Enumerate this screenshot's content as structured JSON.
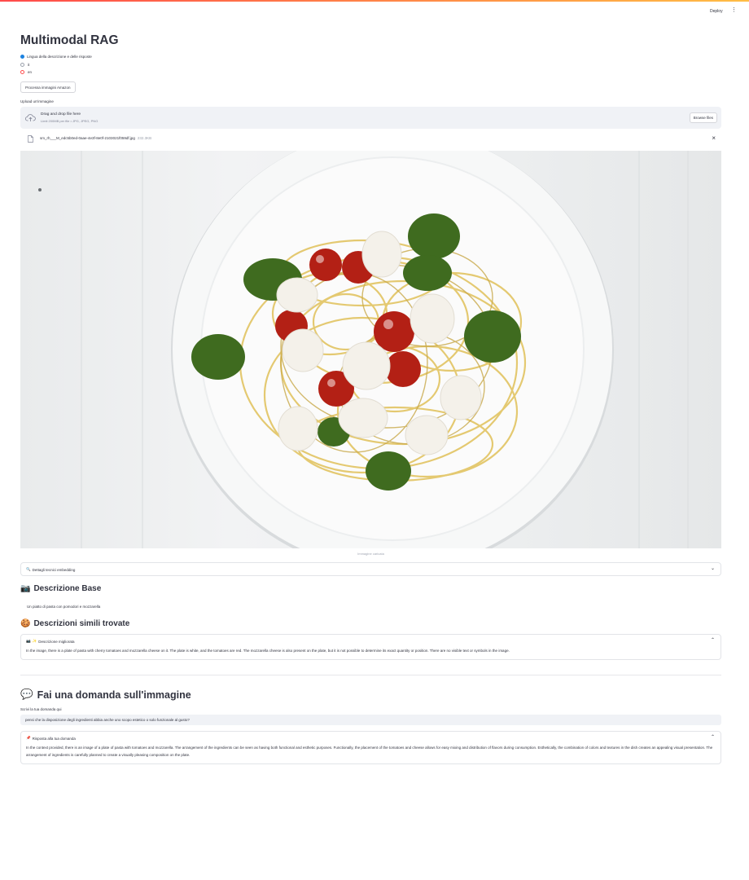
{
  "header": {
    "deploy_label": "Deploy",
    "menu_icon": "kebab-menu-icon"
  },
  "title": "Multimodal RAG",
  "language": {
    "label": "Lingua della descrizione e delle risposte",
    "options": [
      {
        "label": "it",
        "selected": false
      },
      {
        "label": "en",
        "selected": true
      }
    ]
  },
  "process_button": "Processa immagini Amazon",
  "uploader": {
    "label": "Upload un'immagine",
    "drop_title": "Drag and drop file here",
    "drop_subtitle": "Limit 200MB per file • JPG, JPEG, PNG",
    "browse_label": "Browse files",
    "file_name": "sm_rh___M_edc5b0ed-0aae-4e3f-8e0f-2103021f059df.jpg",
    "file_size": "232.3KB"
  },
  "image": {
    "caption": "Immagine caricata"
  },
  "embedding_expander": {
    "label": "Dettagli tecnici embedding"
  },
  "base_section": {
    "title": "Descrizione Base",
    "text": "Un piatto di pasta con pomodori e mozzarella"
  },
  "similar_section": {
    "title": "Descrizioni simili trovate",
    "expander_label": "Descrizione migliorata",
    "text": "In the image, there is a plate of pasta with cherry tomatoes and mozzarella cheese on it. The plate is white, and the tomatoes are red. The mozzarella cheese is also present on the plate, but it is not possible to determine its exact quantity or position. There are no visible text or symbols in the image."
  },
  "question_section": {
    "title": "Fai una domanda sull'immagine",
    "input_label": "Scrivi la tua domanda qui",
    "input_value": "pensi che la disposizione degli ingredienti abbia anche uno scopo estetico o solo funzionale al gusto?",
    "answer_label": "Risposta alla tua domanda",
    "answer_text": "In the context provided, there is an image of a plate of pasta with tomatoes and mozzarella. The arrangement of the ingredients can be seen as having both functional and esthetic purposes. Functionally, the placement of the tomatoes and cheese allows for easy mixing and distribution of flavors during consumption. Esthetically, the combination of colors and textures in the dish creates an appealing visual presentation. The arrangement of ingredients is carefully planned to create a visually pleasing composition on the plate."
  },
  "colors": {
    "accent": "#ff4b4b",
    "input_bg": "#f0f2f6",
    "text": "#31333f"
  }
}
